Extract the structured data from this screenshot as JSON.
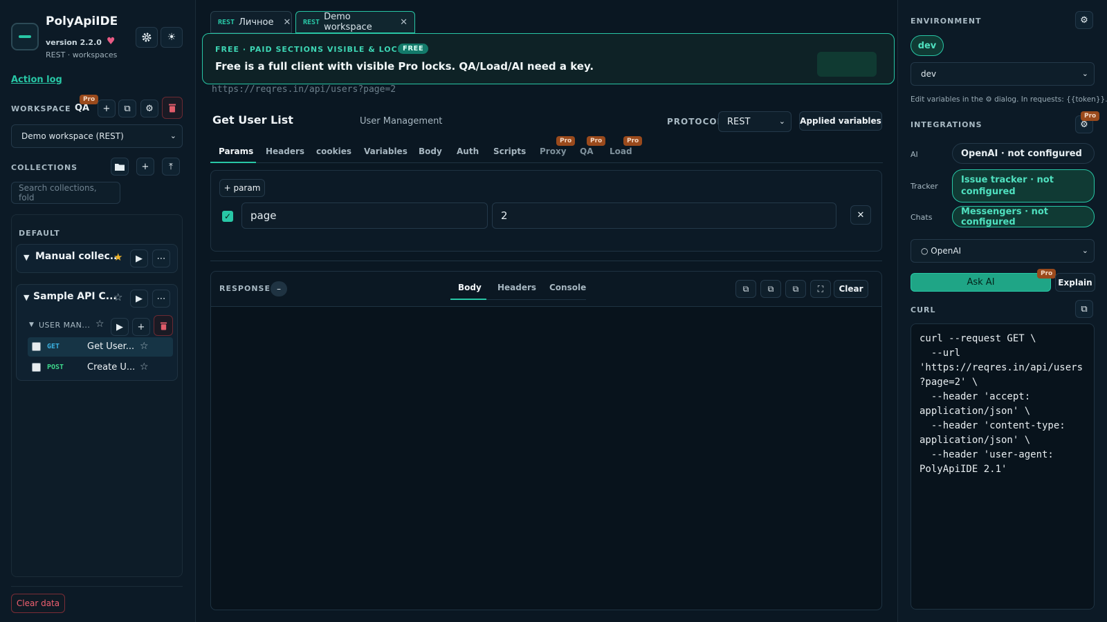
{
  "app": {
    "title": "PolyApiIDE",
    "version": "version 2.2.0",
    "subtitle": "REST · workspaces",
    "action_log": "Action log"
  },
  "sidebar": {
    "workspace_label": "WORKSPACE",
    "workspace_short": "QA",
    "pro_label": "Pro",
    "workspace_select": "Demo workspace (REST)",
    "collections_label": "COLLECTIONS",
    "search_placeholder": "Search collections, fold",
    "group_label": "DEFAULT",
    "collections": [
      {
        "name": "Manual collec...",
        "starred": "★"
      },
      {
        "name": "Sample API C...",
        "starred": "☆"
      }
    ],
    "folder": {
      "name": "USER MAN...",
      "star": "☆"
    },
    "requests": [
      {
        "method": "GET",
        "name": "Get User...",
        "star": "☆",
        "color": "#3ab0e0"
      },
      {
        "method": "POST",
        "name": "Create U...",
        "star": "☆",
        "color": "#3dd68a"
      }
    ],
    "clear_data": "Clear data"
  },
  "tabs": [
    {
      "protocol": "REST",
      "label": "Личное"
    },
    {
      "protocol": "REST",
      "label": "Demo workspace"
    }
  ],
  "banner": {
    "kicker": "FREE · PAID SECTIONS VISIBLE & LOCKED",
    "badge": "FREE",
    "text": "Free is a full client with visible Pro locks. QA/Load/AI need a key."
  },
  "request": {
    "url": "https://reqres.in/api/users?page=2",
    "title": "Get User List",
    "folder": "User Management",
    "protocol_label": "PROTOCOL",
    "protocol_value": "REST",
    "applied_variables": "Applied variables",
    "subtabs": [
      "Params",
      "Headers",
      "cookies",
      "Variables",
      "Body",
      "Auth",
      "Scripts",
      "Proxy",
      "QA",
      "Load"
    ],
    "add_param": "+ param",
    "params": [
      {
        "key": "page",
        "value": "2",
        "enabled": true
      }
    ]
  },
  "response": {
    "label": "RESPONSE",
    "collapse": "–",
    "tabs": [
      "Body",
      "Headers",
      "Console"
    ],
    "clear": "Clear"
  },
  "right": {
    "environment_label": "ENVIRONMENT",
    "env_pill": "dev",
    "env_select": "dev",
    "hint": "Edit variables in the ⚙ dialog. In requests: {{token}}.",
    "integrations_label": "INTEGRATIONS",
    "integrations": [
      {
        "label": "AI",
        "value": "OpenAI · not configured"
      },
      {
        "label": "Tracker",
        "value": "Issue tracker · not configured"
      },
      {
        "label": "Chats",
        "value": "Messengers · not configured"
      }
    ],
    "ai_provider": "○ OpenAI",
    "ask_ai": "Ask AI",
    "explain": "Explain",
    "curl_label": "CURL",
    "curl": "curl --request GET \\\n  --url\n'https://reqres.in/api/users\n?page=2' \\\n  --header 'accept:\napplication/json' \\\n  --header 'content-type:\napplication/json' \\\n  --header 'user-agent:\nPolyApiIDE 2.1'"
  },
  "colors": {
    "accent": "#28c7a6",
    "danger": "#e05c6a",
    "pro": "#9a4a1c"
  }
}
